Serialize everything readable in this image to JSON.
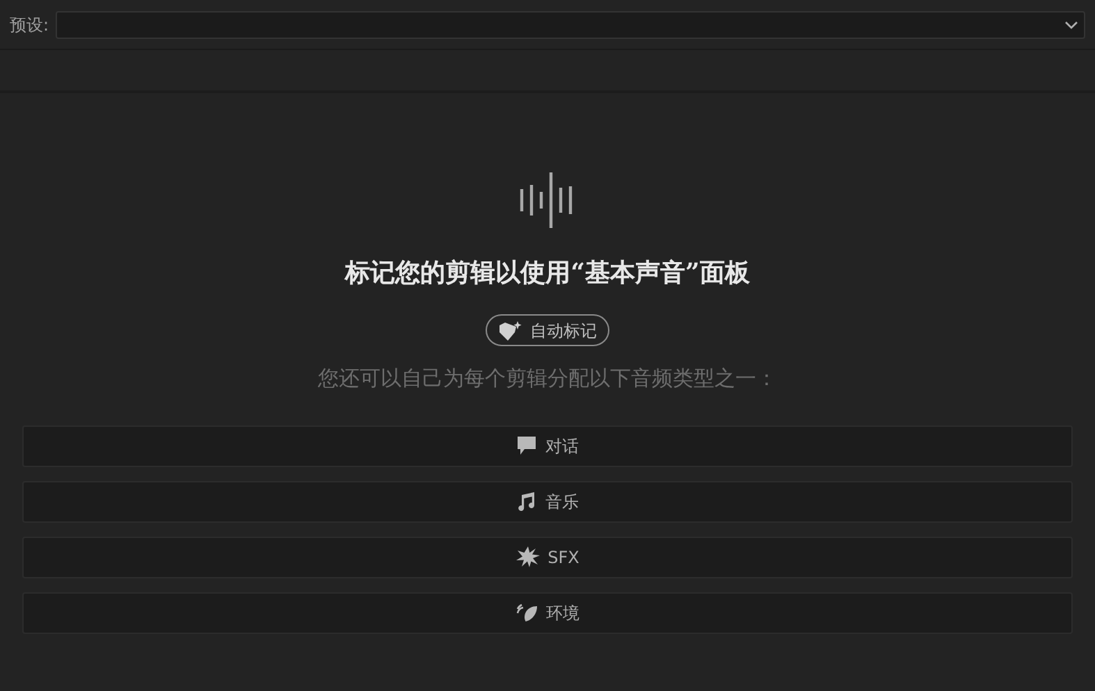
{
  "preset": {
    "label": "预设:"
  },
  "heading": "标记您的剪辑以使用“基本声音”面板",
  "auto_tag_button": {
    "label": "自动标记"
  },
  "instruction": "您还可以自己为每个剪辑分配以下音频类型之一：",
  "audio_types": [
    {
      "kind": "dialogue",
      "label": "对话"
    },
    {
      "kind": "music",
      "label": "音乐"
    },
    {
      "kind": "sfx",
      "label": "SFX"
    },
    {
      "kind": "ambience",
      "label": "环境"
    }
  ]
}
